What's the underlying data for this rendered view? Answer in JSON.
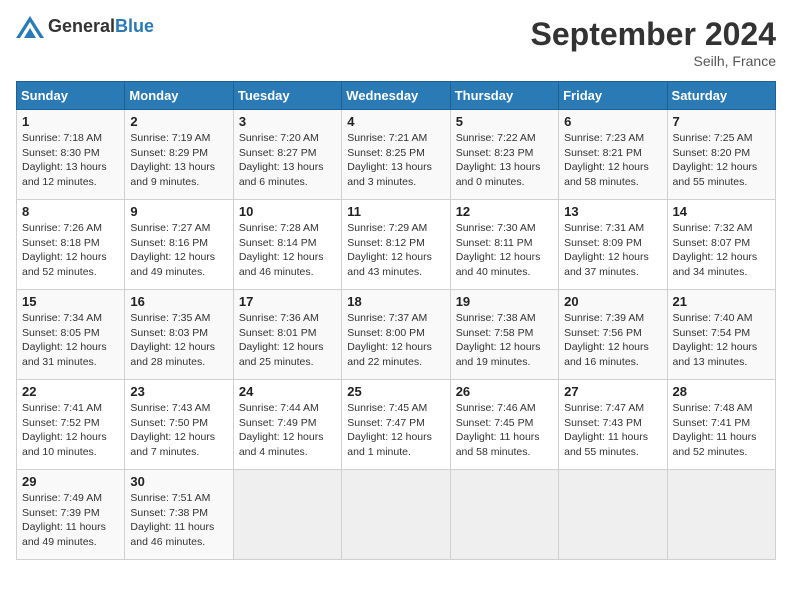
{
  "header": {
    "logo_general": "General",
    "logo_blue": "Blue",
    "month_title": "September 2024",
    "location": "Seilh, France"
  },
  "columns": [
    "Sunday",
    "Monday",
    "Tuesday",
    "Wednesday",
    "Thursday",
    "Friday",
    "Saturday"
  ],
  "weeks": [
    [
      {
        "day": "1",
        "content": "Sunrise: 7:18 AM\nSunset: 8:30 PM\nDaylight: 13 hours\nand 12 minutes."
      },
      {
        "day": "2",
        "content": "Sunrise: 7:19 AM\nSunset: 8:29 PM\nDaylight: 13 hours\nand 9 minutes."
      },
      {
        "day": "3",
        "content": "Sunrise: 7:20 AM\nSunset: 8:27 PM\nDaylight: 13 hours\nand 6 minutes."
      },
      {
        "day": "4",
        "content": "Sunrise: 7:21 AM\nSunset: 8:25 PM\nDaylight: 13 hours\nand 3 minutes."
      },
      {
        "day": "5",
        "content": "Sunrise: 7:22 AM\nSunset: 8:23 PM\nDaylight: 13 hours\nand 0 minutes."
      },
      {
        "day": "6",
        "content": "Sunrise: 7:23 AM\nSunset: 8:21 PM\nDaylight: 12 hours\nand 58 minutes."
      },
      {
        "day": "7",
        "content": "Sunrise: 7:25 AM\nSunset: 8:20 PM\nDaylight: 12 hours\nand 55 minutes."
      }
    ],
    [
      {
        "day": "8",
        "content": "Sunrise: 7:26 AM\nSunset: 8:18 PM\nDaylight: 12 hours\nand 52 minutes."
      },
      {
        "day": "9",
        "content": "Sunrise: 7:27 AM\nSunset: 8:16 PM\nDaylight: 12 hours\nand 49 minutes."
      },
      {
        "day": "10",
        "content": "Sunrise: 7:28 AM\nSunset: 8:14 PM\nDaylight: 12 hours\nand 46 minutes."
      },
      {
        "day": "11",
        "content": "Sunrise: 7:29 AM\nSunset: 8:12 PM\nDaylight: 12 hours\nand 43 minutes."
      },
      {
        "day": "12",
        "content": "Sunrise: 7:30 AM\nSunset: 8:11 PM\nDaylight: 12 hours\nand 40 minutes."
      },
      {
        "day": "13",
        "content": "Sunrise: 7:31 AM\nSunset: 8:09 PM\nDaylight: 12 hours\nand 37 minutes."
      },
      {
        "day": "14",
        "content": "Sunrise: 7:32 AM\nSunset: 8:07 PM\nDaylight: 12 hours\nand 34 minutes."
      }
    ],
    [
      {
        "day": "15",
        "content": "Sunrise: 7:34 AM\nSunset: 8:05 PM\nDaylight: 12 hours\nand 31 minutes."
      },
      {
        "day": "16",
        "content": "Sunrise: 7:35 AM\nSunset: 8:03 PM\nDaylight: 12 hours\nand 28 minutes."
      },
      {
        "day": "17",
        "content": "Sunrise: 7:36 AM\nSunset: 8:01 PM\nDaylight: 12 hours\nand 25 minutes."
      },
      {
        "day": "18",
        "content": "Sunrise: 7:37 AM\nSunset: 8:00 PM\nDaylight: 12 hours\nand 22 minutes."
      },
      {
        "day": "19",
        "content": "Sunrise: 7:38 AM\nSunset: 7:58 PM\nDaylight: 12 hours\nand 19 minutes."
      },
      {
        "day": "20",
        "content": "Sunrise: 7:39 AM\nSunset: 7:56 PM\nDaylight: 12 hours\nand 16 minutes."
      },
      {
        "day": "21",
        "content": "Sunrise: 7:40 AM\nSunset: 7:54 PM\nDaylight: 12 hours\nand 13 minutes."
      }
    ],
    [
      {
        "day": "22",
        "content": "Sunrise: 7:41 AM\nSunset: 7:52 PM\nDaylight: 12 hours\nand 10 minutes."
      },
      {
        "day": "23",
        "content": "Sunrise: 7:43 AM\nSunset: 7:50 PM\nDaylight: 12 hours\nand 7 minutes."
      },
      {
        "day": "24",
        "content": "Sunrise: 7:44 AM\nSunset: 7:49 PM\nDaylight: 12 hours\nand 4 minutes."
      },
      {
        "day": "25",
        "content": "Sunrise: 7:45 AM\nSunset: 7:47 PM\nDaylight: 12 hours\nand 1 minute."
      },
      {
        "day": "26",
        "content": "Sunrise: 7:46 AM\nSunset: 7:45 PM\nDaylight: 11 hours\nand 58 minutes."
      },
      {
        "day": "27",
        "content": "Sunrise: 7:47 AM\nSunset: 7:43 PM\nDaylight: 11 hours\nand 55 minutes."
      },
      {
        "day": "28",
        "content": "Sunrise: 7:48 AM\nSunset: 7:41 PM\nDaylight: 11 hours\nand 52 minutes."
      }
    ],
    [
      {
        "day": "29",
        "content": "Sunrise: 7:49 AM\nSunset: 7:39 PM\nDaylight: 11 hours\nand 49 minutes."
      },
      {
        "day": "30",
        "content": "Sunrise: 7:51 AM\nSunset: 7:38 PM\nDaylight: 11 hours\nand 46 minutes."
      },
      {
        "day": "",
        "content": ""
      },
      {
        "day": "",
        "content": ""
      },
      {
        "day": "",
        "content": ""
      },
      {
        "day": "",
        "content": ""
      },
      {
        "day": "",
        "content": ""
      }
    ]
  ]
}
